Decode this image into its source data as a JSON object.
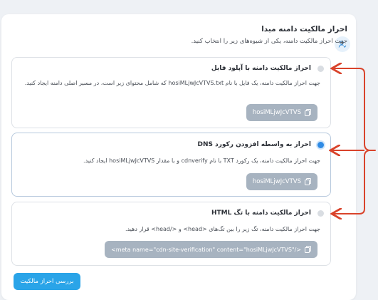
{
  "header": {
    "title": "احراز مالکیت دامنه مبدا",
    "subtitle": "جهت احراز مالکیت دامنه، یکی از شیوه‌های زیر را انتخاب کنید.",
    "icon": "user-check-icon"
  },
  "methods": [
    {
      "title": "احراز مالکیت دامنه با آپلود فایل",
      "description": "جهت احراز مالکیت دامنه، یک فایل با نام hosiMLjwJcVTVS.txt که شامل محتوای زیر است، در مسیر اصلی دامنه ایجاد کنید.",
      "code": "hosiMLjwJcVTVS",
      "selected": false
    },
    {
      "title": "احراز به واسطه افزودن رکورد DNS",
      "description": "جهت احراز مالکیت دامنه، یک رکورد TXT با نام cdnverify و با مقدار hosiMLjwJcVTVS ایجاد کنید.",
      "code": "hosiMLjwJcVTVS",
      "selected": true
    },
    {
      "title": "احراز مالکیت دامنه با تگ HTML",
      "description": "جهت احراز مالکیت دامنه، تگ زیر را بین تگ‌های <head> و </head> قرار دهید.",
      "code": "<meta name=\"cdn-site-verification\" content=\"hosiMLjwJcVTVS\"/>",
      "selected": false
    }
  ],
  "verify_button": "بررسی احراز مالکیت",
  "colors": {
    "accent": "#2aa4e8",
    "annotation": "#d9432b",
    "code_bg": "#a7b3c0"
  }
}
